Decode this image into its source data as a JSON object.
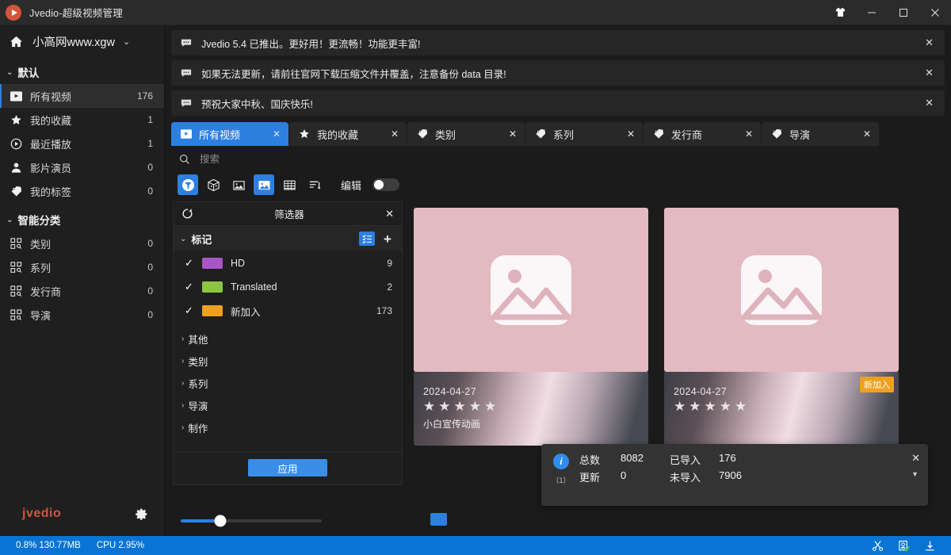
{
  "window": {
    "title": "Jvedio-超级视频管理",
    "logo_icon": "jvedio-logo-icon",
    "theme_icon": "tshirt-icon",
    "minimize_icon": "minimize-icon",
    "maximize_icon": "maximize-icon",
    "close_icon": "close-icon"
  },
  "sidebar": {
    "home_icon": "home-icon",
    "library_name": "小高网www.xgw",
    "library_caret": "chevron-down-icon",
    "groups": [
      {
        "label": "默认",
        "items": [
          {
            "label": "所有视频",
            "count": "176",
            "icon": "play-box-icon",
            "active": true
          },
          {
            "label": "我的收藏",
            "count": "1",
            "icon": "star-icon",
            "active": false
          },
          {
            "label": "最近播放",
            "count": "1",
            "icon": "recent-play-icon",
            "active": false
          },
          {
            "label": "影片演员",
            "count": "0",
            "icon": "person-icon",
            "active": false
          },
          {
            "label": "我的标签",
            "count": "0",
            "icon": "tag-icon",
            "active": false
          }
        ]
      },
      {
        "label": "智能分类",
        "items": [
          {
            "label": "类别",
            "count": "0",
            "icon": "category-grid-icon",
            "active": false
          },
          {
            "label": "系列",
            "count": "0",
            "icon": "category-grid-icon",
            "active": false
          },
          {
            "label": "发行商",
            "count": "0",
            "icon": "category-grid-icon",
            "active": false
          },
          {
            "label": "导演",
            "count": "0",
            "icon": "category-grid-icon",
            "active": false
          }
        ]
      }
    ],
    "brand": "jvedio",
    "settings_icon": "gear-icon"
  },
  "notices": [
    {
      "icon": "message-icon",
      "text": "Jvedio 5.4 已推出。更好用！更流畅！功能更丰富!",
      "close": "✕"
    },
    {
      "icon": "message-icon",
      "text": "如果无法更新，请前往官网下载压缩文件并覆盖，注意备份 data 目录!",
      "close": "✕"
    },
    {
      "icon": "message-icon",
      "text": "预祝大家中秋、国庆快乐!",
      "close": "✕"
    }
  ],
  "tabs": [
    {
      "label": "所有视频",
      "icon": "play-box-icon",
      "active": true,
      "close": "✕"
    },
    {
      "label": "我的收藏",
      "icon": "star-icon",
      "active": false,
      "close": "✕"
    },
    {
      "label": "类别",
      "icon": "tag-icon",
      "active": false,
      "close": "✕"
    },
    {
      "label": "系列",
      "icon": "tag-icon",
      "active": false,
      "close": "✕"
    },
    {
      "label": "发行商",
      "icon": "tag-icon",
      "active": false,
      "close": "✕"
    },
    {
      "label": "导演",
      "icon": "tag-icon",
      "active": false,
      "close": "✕"
    }
  ],
  "search": {
    "icon": "search-icon",
    "value": "",
    "placeholder": "搜索"
  },
  "toolbar": {
    "buttons": [
      {
        "icon": "filter-funnel-icon",
        "active": true
      },
      {
        "icon": "dice-random-icon",
        "active": false
      },
      {
        "icon": "image-small-icon",
        "active": false
      },
      {
        "icon": "image-large-icon",
        "active": true
      },
      {
        "icon": "table-view-icon",
        "active": false
      },
      {
        "icon": "sort-list-icon",
        "active": false
      }
    ],
    "edit_label": "编辑",
    "edit_toggle_on": false
  },
  "filter": {
    "refresh_icon": "refresh-icon",
    "title": "筛选器",
    "close_icon": "close-icon",
    "section": {
      "label": "标记",
      "chevron": "chevron-down-icon",
      "select_all_icon": "select-all-icon",
      "add_icon": "plus-icon"
    },
    "rows": [
      {
        "checked": true,
        "color": "#a855c8",
        "label": "HD",
        "count": "9"
      },
      {
        "checked": true,
        "color": "#8cc63f",
        "label": "Translated",
        "count": "2"
      },
      {
        "checked": true,
        "color": "#f0a020",
        "label": "新加入",
        "count": "173"
      }
    ],
    "categories": [
      {
        "label": "其他",
        "chevron": "chevron-right-icon"
      },
      {
        "label": "类别",
        "chevron": "chevron-right-icon"
      },
      {
        "label": "系列",
        "chevron": "chevron-right-icon"
      },
      {
        "label": "导演",
        "chevron": "chevron-right-icon"
      },
      {
        "label": "制作",
        "chevron": "chevron-right-icon"
      }
    ],
    "apply_label": "应用"
  },
  "zoom_slider": {
    "value_pct": 28
  },
  "cards": [
    {
      "date": "2024-04-27",
      "stars": 5,
      "title": "小白宣传动画",
      "badge": "",
      "placeholder_icon": "image-placeholder-icon"
    },
    {
      "date": "2024-04-27",
      "stars": 5,
      "title": "",
      "badge": "新加入",
      "placeholder_icon": "image-placeholder-icon"
    }
  ],
  "toast": {
    "info_icon": "info-icon",
    "index": "（1）",
    "labels": {
      "total": "总数",
      "imported": "已导入",
      "updated": "更新",
      "not_imported": "未导入"
    },
    "values": {
      "total": "8082",
      "imported": "176",
      "updated": "0",
      "not_imported": "7906"
    },
    "close_icon": "close-icon",
    "caret_icon": "caret-down-icon"
  },
  "statusbar": {
    "memory": "0.8% 130.77MB",
    "cpu": "CPU 2.95%",
    "icons": [
      {
        "name": "scissors-icon"
      },
      {
        "name": "scan-check-icon"
      },
      {
        "name": "download-icon"
      }
    ]
  }
}
